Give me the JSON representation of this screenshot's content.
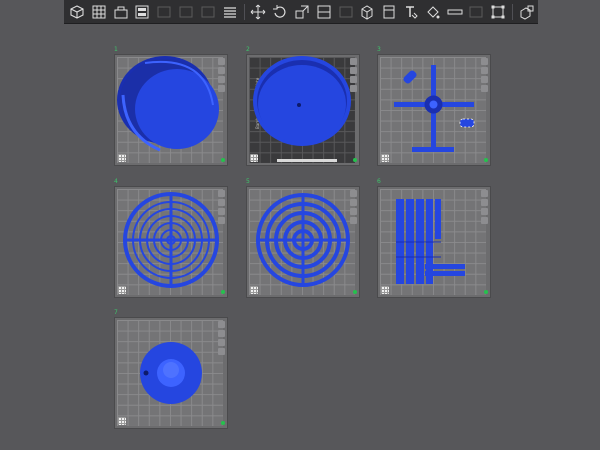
{
  "toolbar": {
    "buttons": [
      {
        "icon": "add-cube-icon",
        "enabled": true
      },
      {
        "icon": "grid-icon",
        "enabled": true
      },
      {
        "icon": "import-plate-icon",
        "enabled": true
      },
      {
        "icon": "layout-icon",
        "enabled": true
      },
      {
        "icon": "undo-icon",
        "enabled": false
      },
      {
        "icon": "redo-icon",
        "enabled": false
      },
      {
        "icon": "arrange-icon",
        "enabled": false
      },
      {
        "icon": "menu-icon",
        "enabled": true
      },
      {
        "icon": "move-icon",
        "enabled": true
      },
      {
        "icon": "rotate-icon",
        "enabled": true
      },
      {
        "icon": "scale-icon",
        "enabled": true
      },
      {
        "icon": "lay-on-face-icon",
        "enabled": true
      },
      {
        "icon": "cut-icon",
        "enabled": false
      },
      {
        "icon": "cube-icon",
        "enabled": true
      },
      {
        "icon": "support-paint-icon",
        "enabled": true
      },
      {
        "icon": "text-icon",
        "enabled": true
      },
      {
        "icon": "paint-bucket-icon",
        "enabled": true
      },
      {
        "icon": "measure-icon",
        "enabled": true
      },
      {
        "icon": "split-icon",
        "enabled": false
      },
      {
        "icon": "boundary-icon",
        "enabled": true
      },
      {
        "icon": "assembly-icon",
        "enabled": true
      }
    ]
  },
  "plates": [
    {
      "index": "1",
      "model": "cup-tilted",
      "dark": false
    },
    {
      "index": "2",
      "model": "cup-round",
      "dark": true,
      "side_text": "Bambu Textured PEI Plate",
      "strip_text": "Bambu Textured PEI Plate"
    },
    {
      "index": "3",
      "model": "parts-cross",
      "dark": false
    },
    {
      "index": "4",
      "model": "wheel-spokes",
      "dark": false
    },
    {
      "index": "5",
      "model": "wheel-rings",
      "dark": false
    },
    {
      "index": "6",
      "model": "bars",
      "dark": false
    },
    {
      "index": "7",
      "model": "dome",
      "dark": false
    }
  ],
  "colors": {
    "model": "#2546e0",
    "model_dark": "#1630b8",
    "model_light": "#3d63ff",
    "status_ok": "#25c14d"
  }
}
